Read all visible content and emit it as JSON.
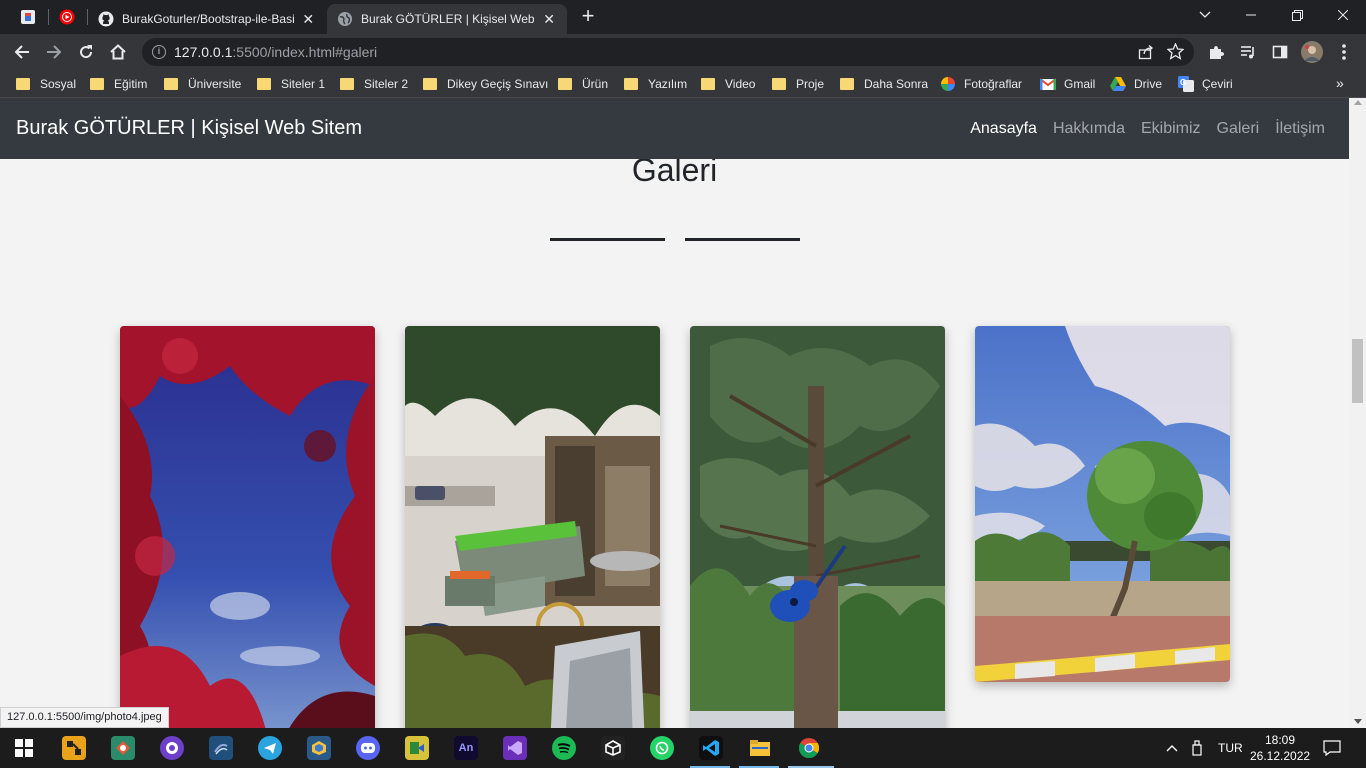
{
  "browser": {
    "tabs": [
      {
        "title": "BurakGoturler/Bootstrap-ile-Basit-Kişisel-Web-Sitesi",
        "favicon": "github-icon",
        "active": false
      },
      {
        "title": "Burak GÖTÜRLER | Kişisel Web Sitem",
        "favicon": "globe-icon",
        "active": true
      }
    ],
    "close_glyph": "✕",
    "new_tab_glyph": "+",
    "url_host": "127.0.0.1",
    "url_rest": ":5500/index.html#galeri",
    "bookmarks": [
      {
        "label": "Sosyal",
        "icon": "folder-icon"
      },
      {
        "label": "Eğitim",
        "icon": "folder-icon"
      },
      {
        "label": "Üniversite",
        "icon": "folder-icon"
      },
      {
        "label": "Siteler 1",
        "icon": "folder-icon"
      },
      {
        "label": "Siteler 2",
        "icon": "folder-icon"
      },
      {
        "label": "Dikey Geçiş Sınavı",
        "icon": "folder-icon"
      },
      {
        "label": "Ürün",
        "icon": "folder-icon"
      },
      {
        "label": "Yazılım",
        "icon": "folder-icon"
      },
      {
        "label": "Video",
        "icon": "folder-icon"
      },
      {
        "label": "Proje",
        "icon": "folder-icon"
      },
      {
        "label": "Daha Sonra",
        "icon": "folder-icon"
      },
      {
        "label": "Fotoğraflar",
        "icon": "google-photos-icon"
      },
      {
        "label": "Gmail",
        "icon": "gmail-icon"
      },
      {
        "label": "Drive",
        "icon": "google-drive-icon"
      },
      {
        "label": "Çeviri",
        "icon": "google-translate-icon"
      }
    ],
    "bookmarks_more": "»",
    "status_url": "127.0.0.1:5500/img/photo4.jpeg"
  },
  "site": {
    "brand": "Burak GÖTÜRLER | Kişisel Web Sitem",
    "nav": [
      {
        "label": "Anasayfa",
        "active": true
      },
      {
        "label": "Hakkımda",
        "active": false
      },
      {
        "label": "Ekibimiz",
        "active": false
      },
      {
        "label": "Galeri",
        "active": false
      },
      {
        "label": "İletişim",
        "active": false
      }
    ],
    "section_title": "Galeri",
    "gallery": [
      {
        "name": "photo-red-leaves"
      },
      {
        "name": "photo-garden-cart"
      },
      {
        "name": "photo-pine-guitar"
      },
      {
        "name": "photo-tree-sky"
      }
    ]
  },
  "taskbar": {
    "apps": [
      "visual-paradigm-icon",
      "gitkraken-icon",
      "github-desktop-icon",
      "sql-server-icon",
      "telegram-icon",
      "virtualbox-icon",
      "discord-icon",
      "winscp-icon",
      "animate-icon",
      "visual-studio-icon",
      "spotify-icon",
      "unity-icon",
      "whatsapp-icon",
      "vscode-icon",
      "file-explorer-icon",
      "chrome-icon"
    ],
    "animate_label": "An",
    "language": "TUR",
    "tray_chevron": "^",
    "time": "18:09",
    "date": "26.12.2022"
  },
  "colors": {
    "navbar_bg": "#343a40",
    "page_bg": "#f3f3f3",
    "chrome_dark": "#202124",
    "chrome_toolbar": "#35363a"
  }
}
